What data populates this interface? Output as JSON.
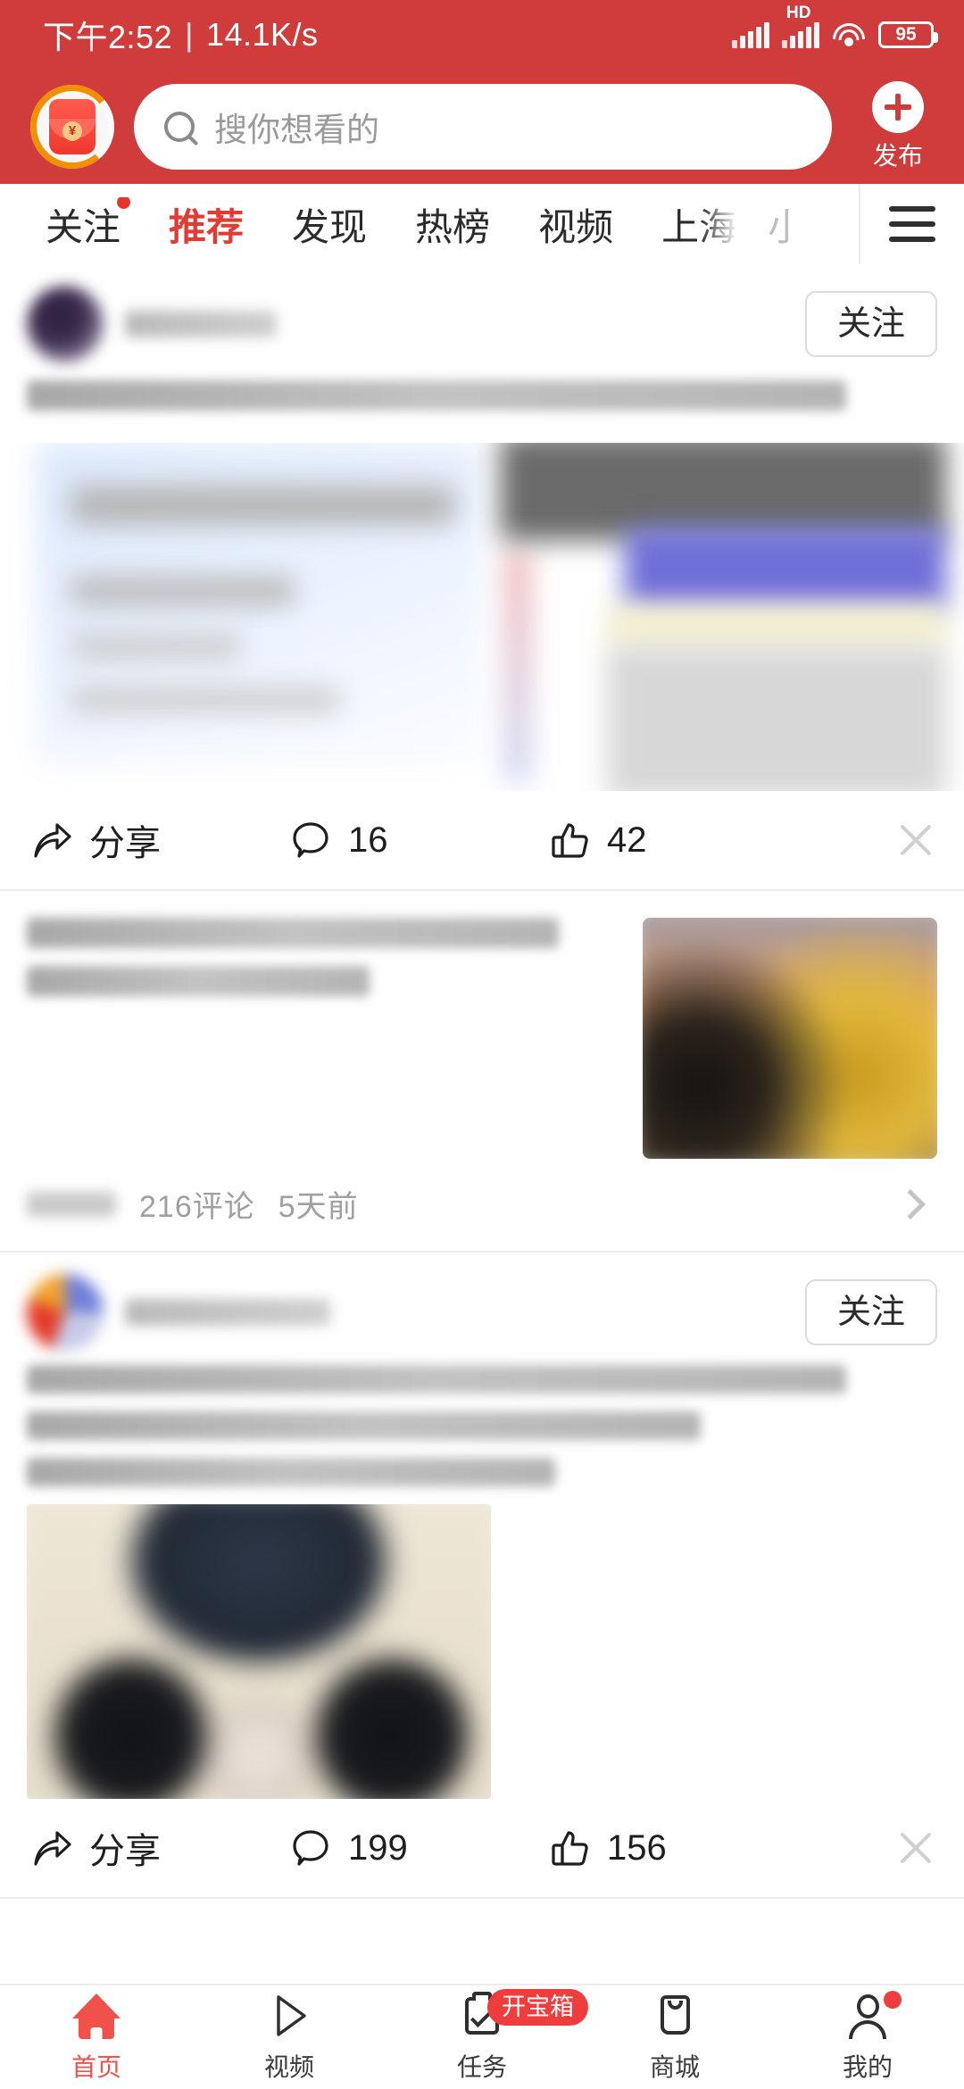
{
  "status_bar": {
    "time": "下午2:52",
    "separator": "|",
    "net_speed": "14.1K/s",
    "hd_label": "HD",
    "battery_percent": "95",
    "icons": [
      "signal-bars-icon",
      "signal-bars-hd-icon",
      "wifi-icon",
      "battery-icon"
    ]
  },
  "header": {
    "avatar_icon": "red-envelope-icon",
    "avatar_currency": "¥",
    "search_placeholder": "搜你想看的",
    "search_value": "",
    "search_icon": "search-icon",
    "publish_label": "发布",
    "publish_icon": "plus-icon",
    "background_color": "#d03c3c"
  },
  "tabs": {
    "items": [
      {
        "label": "关注",
        "active": false,
        "badge": true
      },
      {
        "label": "推荐",
        "active": true,
        "badge": false
      },
      {
        "label": "发现",
        "active": false,
        "badge": false
      },
      {
        "label": "热榜",
        "active": false,
        "badge": false
      },
      {
        "label": "视频",
        "active": false,
        "badge": false
      },
      {
        "label": "上海",
        "active": false,
        "badge": false
      },
      {
        "label": "小",
        "active": false,
        "badge": false
      }
    ],
    "menu_icon": "hamburger-menu-icon",
    "active_color": "#e13b33"
  },
  "feed": {
    "posts": [
      {
        "id": "post-1",
        "follow_label": "关注",
        "actions": {
          "share_label": "分享",
          "share_icon": "share-icon",
          "comment_count": "16",
          "comment_icon": "comment-icon",
          "like_count": "42",
          "like_icon": "thumbs-up-icon",
          "close_icon": "close-icon"
        }
      },
      {
        "id": "post-2",
        "meta_comments": "216评论",
        "meta_time": "5天前",
        "chevron_icon": "chevron-right-icon"
      },
      {
        "id": "post-3",
        "follow_label": "关注",
        "actions": {
          "share_label": "分享",
          "share_icon": "share-icon",
          "comment_count": "199",
          "comment_icon": "comment-icon",
          "like_count": "156",
          "like_icon": "thumbs-up-icon",
          "close_icon": "close-icon"
        }
      }
    ]
  },
  "bottom_nav": {
    "items": [
      {
        "label": "首页",
        "icon": "home-icon",
        "active": true,
        "badge": "",
        "dot": false
      },
      {
        "label": "视频",
        "icon": "play-icon",
        "active": false,
        "badge": "",
        "dot": false
      },
      {
        "label": "任务",
        "icon": "task-clipboard-icon",
        "active": false,
        "badge": "开宝箱",
        "dot": false
      },
      {
        "label": "商城",
        "icon": "shopping-bag-icon",
        "active": false,
        "badge": "",
        "dot": false
      },
      {
        "label": "我的",
        "icon": "person-icon",
        "active": false,
        "badge": "",
        "dot": true
      }
    ],
    "active_color": "#f0514b",
    "badge_color": "#ef3d3d"
  }
}
